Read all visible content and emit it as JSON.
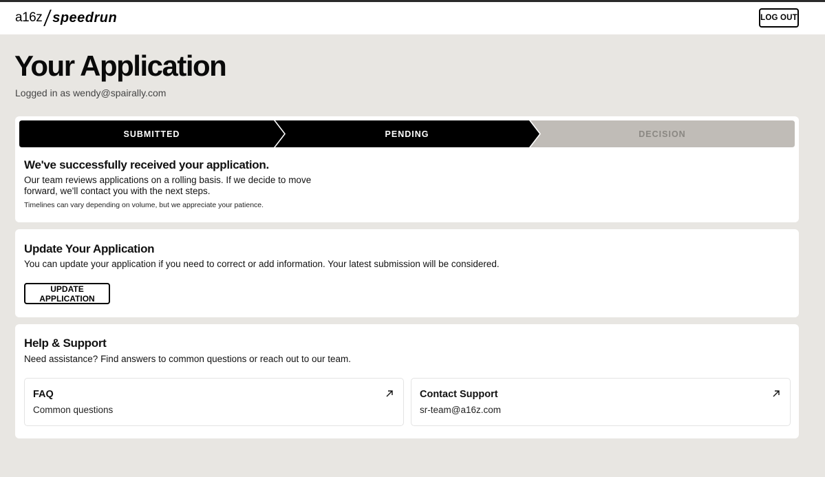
{
  "header": {
    "logo_left": "a16z",
    "logo_right": "speedrun",
    "logout_label": "LOG OUT"
  },
  "page": {
    "title": "Your Application",
    "subtitle": "Logged in as wendy@spairally.com"
  },
  "status": {
    "steps": [
      {
        "label": "SUBMITTED",
        "state": "complete"
      },
      {
        "label": "PENDING",
        "state": "current"
      },
      {
        "label": "DECISION",
        "state": "upcoming"
      }
    ],
    "heading": "We've successfully received your application.",
    "body": "Our team reviews applications on a rolling basis. If we decide to move forward, we'll contact you with the next steps.",
    "note": "Timelines can vary depending on volume, but we appreciate your patience."
  },
  "update": {
    "heading": "Update Your Application",
    "body": "You can update your application if you need to correct or add information. Your latest submission will be considered.",
    "button_label": "UPDATE APPLICATION"
  },
  "help": {
    "heading": "Help & Support",
    "body": "Need assistance? Find answers to common questions or reach out to our team.",
    "links": [
      {
        "title": "FAQ",
        "subtitle": "Common questions",
        "icon": "arrow-up-right-icon"
      },
      {
        "title": "Contact Support",
        "subtitle": "sr-team@a16z.com",
        "icon": "arrow-up-right-icon"
      }
    ]
  },
  "colors": {
    "background": "#e8e6e2",
    "step_active": "#000000",
    "step_inactive": "#c0bcb7"
  }
}
